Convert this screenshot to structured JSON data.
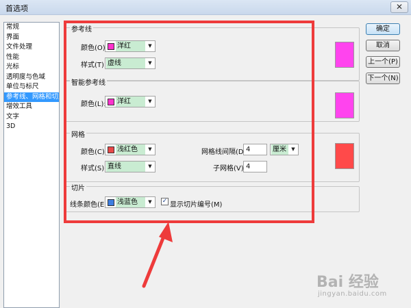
{
  "window": {
    "title": "首选项",
    "close_glyph": "✕"
  },
  "nav": {
    "items": [
      {
        "label": "常规"
      },
      {
        "label": "界面"
      },
      {
        "label": "文件处理"
      },
      {
        "label": "性能"
      },
      {
        "label": "光标"
      },
      {
        "label": "透明度与色域"
      },
      {
        "label": "单位与标尺"
      },
      {
        "label": "参考线、网格和切片"
      },
      {
        "label": "增效工具"
      },
      {
        "label": "文字"
      },
      {
        "label": "3D"
      }
    ],
    "selected_index": 7
  },
  "guides": {
    "group_label": "参考线",
    "color_label": "颜色(O):",
    "color_value": "洋红",
    "color_swatch": "#ff33cc",
    "style_label": "样式(T):",
    "style_value": "虚线",
    "preview_color": "#ff44ee"
  },
  "smart_guides": {
    "group_label": "智能参考线",
    "color_label": "颜色(L):",
    "color_value": "洋红",
    "color_swatch": "#ff33cc",
    "preview_color": "#ff44ee"
  },
  "grid": {
    "group_label": "网格",
    "color_label": "颜色(C):",
    "color_value": "浅红色",
    "color_swatch": "#e84848",
    "style_label": "样式(S):",
    "style_value": "直线",
    "gridline_label": "网格线间隔(D):",
    "gridline_value": "4",
    "unit_value": "厘米",
    "subdiv_label": "子网格(V):",
    "subdiv_value": "4",
    "preview_color": "#ff4a4a"
  },
  "slices": {
    "group_label": "切片",
    "line_color_label": "线条颜色(E):",
    "line_color_value": "浅蓝色",
    "line_color_swatch": "#3f7fe0",
    "show_numbers_label": "显示切片编号(M)",
    "show_numbers_checked": true,
    "check_glyph": "✓"
  },
  "buttons": {
    "ok": "确定",
    "cancel": "取消",
    "prev": "上一个(P)",
    "next": "下一个(N)"
  },
  "dropdown_glyph": "▼",
  "watermark": {
    "brand": "Bai 经验",
    "url": "jingyan.baidu.com"
  },
  "colors": {
    "highlight": "#ee3b3b",
    "nav_selected": "#3399ff",
    "field_highlight": "#c9ecd2"
  }
}
